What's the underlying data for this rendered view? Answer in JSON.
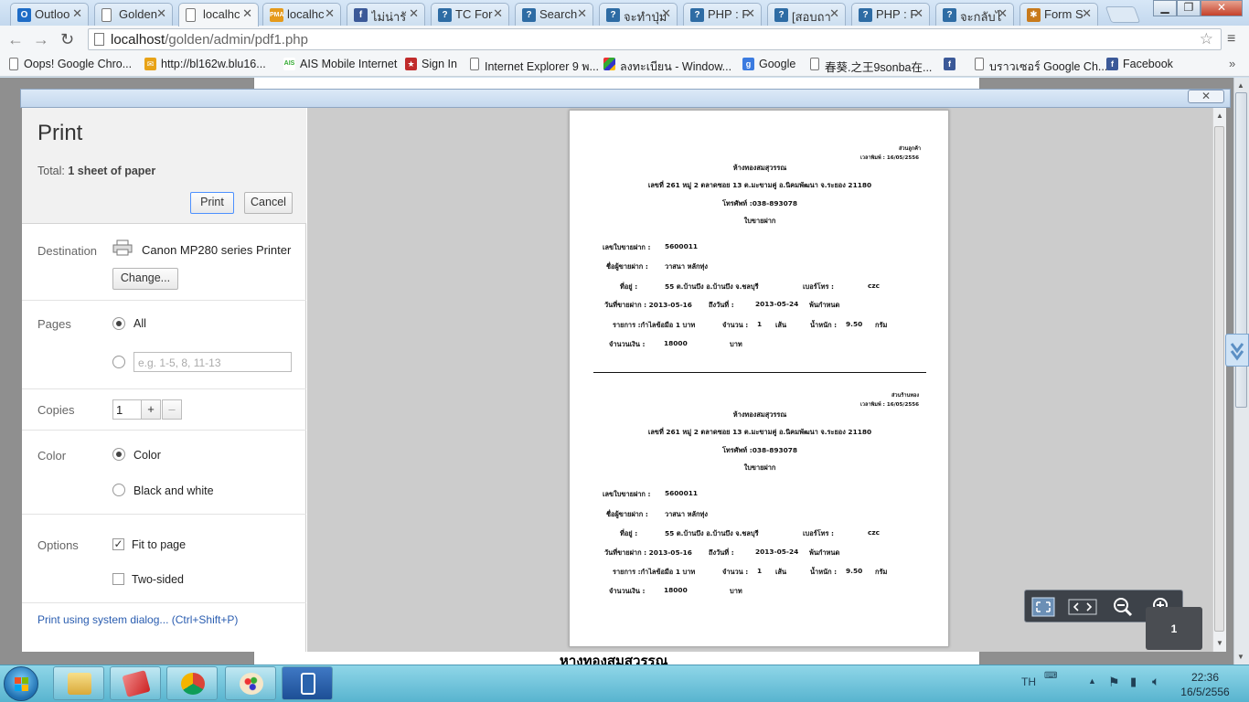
{
  "browser": {
    "tabs": [
      {
        "label": "Outloo",
        "favicon": "outlook-icon",
        "active": false
      },
      {
        "label": "Golden",
        "favicon": "page-icon",
        "active": false
      },
      {
        "label": "localhc",
        "favicon": "page-icon",
        "active": true
      },
      {
        "label": "localhc",
        "favicon": "phpmyadmin-icon",
        "active": false
      },
      {
        "label": "ไม่น่ารั",
        "favicon": "facebook-icon",
        "active": false
      },
      {
        "label": "TC For",
        "favicon": "forum-icon",
        "active": false
      },
      {
        "label": "Search",
        "favicon": "forum-icon",
        "active": false
      },
      {
        "label": "จะทำปุ่ม",
        "favicon": "forum-icon",
        "active": false
      },
      {
        "label": "PHP : F",
        "favicon": "forum-icon",
        "active": false
      },
      {
        "label": "[สอบถา",
        "favicon": "forum-icon",
        "active": false
      },
      {
        "label": "PHP : F",
        "favicon": "forum-icon",
        "active": false
      },
      {
        "label": "จะกลับไ",
        "favicon": "forum-icon",
        "active": false
      },
      {
        "label": "Form S",
        "favicon": "gear-icon",
        "active": false
      }
    ],
    "url_host": "localhost",
    "url_path": "/golden/admin/pdf1.php",
    "bookmarks": [
      "Oops! Google Chro...",
      "http://bl162w.blu16...",
      "AIS Mobile Internet",
      "Sign In",
      "Internet Explorer 9 พ...",
      "ลงทะเบียน - Window...",
      "Google",
      "春葵.之王9sonba在...",
      "",
      "บราวเซอร์ Google Ch...",
      "Facebook"
    ]
  },
  "behind_page": {
    "bottom_text": "หางทองสมสุวรรณ"
  },
  "print_dialog": {
    "title": "Print",
    "total_label": "Total:",
    "total_value": "1 sheet of paper",
    "print_button": "Print",
    "cancel_button": "Cancel",
    "destination_label": "Destination",
    "printer_name": "Canon MP280 series Printer",
    "change_button": "Change...",
    "pages_label": "Pages",
    "pages_all": "All",
    "pages_placeholder": "e.g. 1-5, 8, 11-13",
    "copies_label": "Copies",
    "copies_value": "1",
    "plus": "+",
    "minus": "–",
    "color_label": "Color",
    "color_option": "Color",
    "bw_option": "Black and white",
    "options_label": "Options",
    "fit_to_page": "Fit to page",
    "two_sided": "Two-sided",
    "system_dialog_link": "Print using system dialog... (Ctrl+Shift+P)"
  },
  "receipt": {
    "part1_label": "ส่วนลูกค้า",
    "part2_label": "ส่วนร้านทอง",
    "print_time": "เวลาพิมพ์ : 16/05/2556",
    "shop_name": "ห้างทองสมสุวรรณ",
    "address": "เลขที่ 261 หมู่ 2 ตลาดซอย 13  ต.มะขามคู่ อ.นิคมพัฒนา  จ.ระยอง  21180",
    "phone": "โทรศัพท์ :038-893078",
    "doc_title": "ใบขายฝาก",
    "receipt_no_label": "เลขใบขายฝาก :",
    "receipt_no": "5600011",
    "seller_label": "ชื่อผู้ขายฝาก :",
    "seller_name": "วาสนา   หลักทุ่ง",
    "addr_label": "ที่อยู่ :",
    "addr_value": "55  ต.บ้านบึง  อ.บ้านบึง  จ.ชลบุรี",
    "tel_label": "เบอร์โทร :",
    "tel_value": "czc",
    "date_label": "วันที่ขายฝาก :  2013-05-16",
    "until_label": "ถึงวันที่ :",
    "until_value": "2013-05-24",
    "due_label": "พ้นกำหนด",
    "item_label": "รายการ  :กำไลข้อมือ  1 บาท",
    "qty_label": "จำนวน :",
    "qty_value": "1",
    "qty_unit": "เส้น",
    "weight_label": "น้ำหนัก :",
    "weight_value": "9.50",
    "weight_unit": "กรัม",
    "amount_label": "จำนวนเงิน :",
    "amount_value": "18000",
    "amount_unit": "บาท"
  },
  "preview": {
    "page_number": "1"
  },
  "taskbar": {
    "language": "TH",
    "time": "22:36",
    "date": "16/5/2556"
  },
  "colors": {
    "accent_link": "#2a5db0",
    "primary_button_border": "#4d90fe",
    "preview_background": "#cccccc",
    "taskbar": "#58b4cf"
  }
}
